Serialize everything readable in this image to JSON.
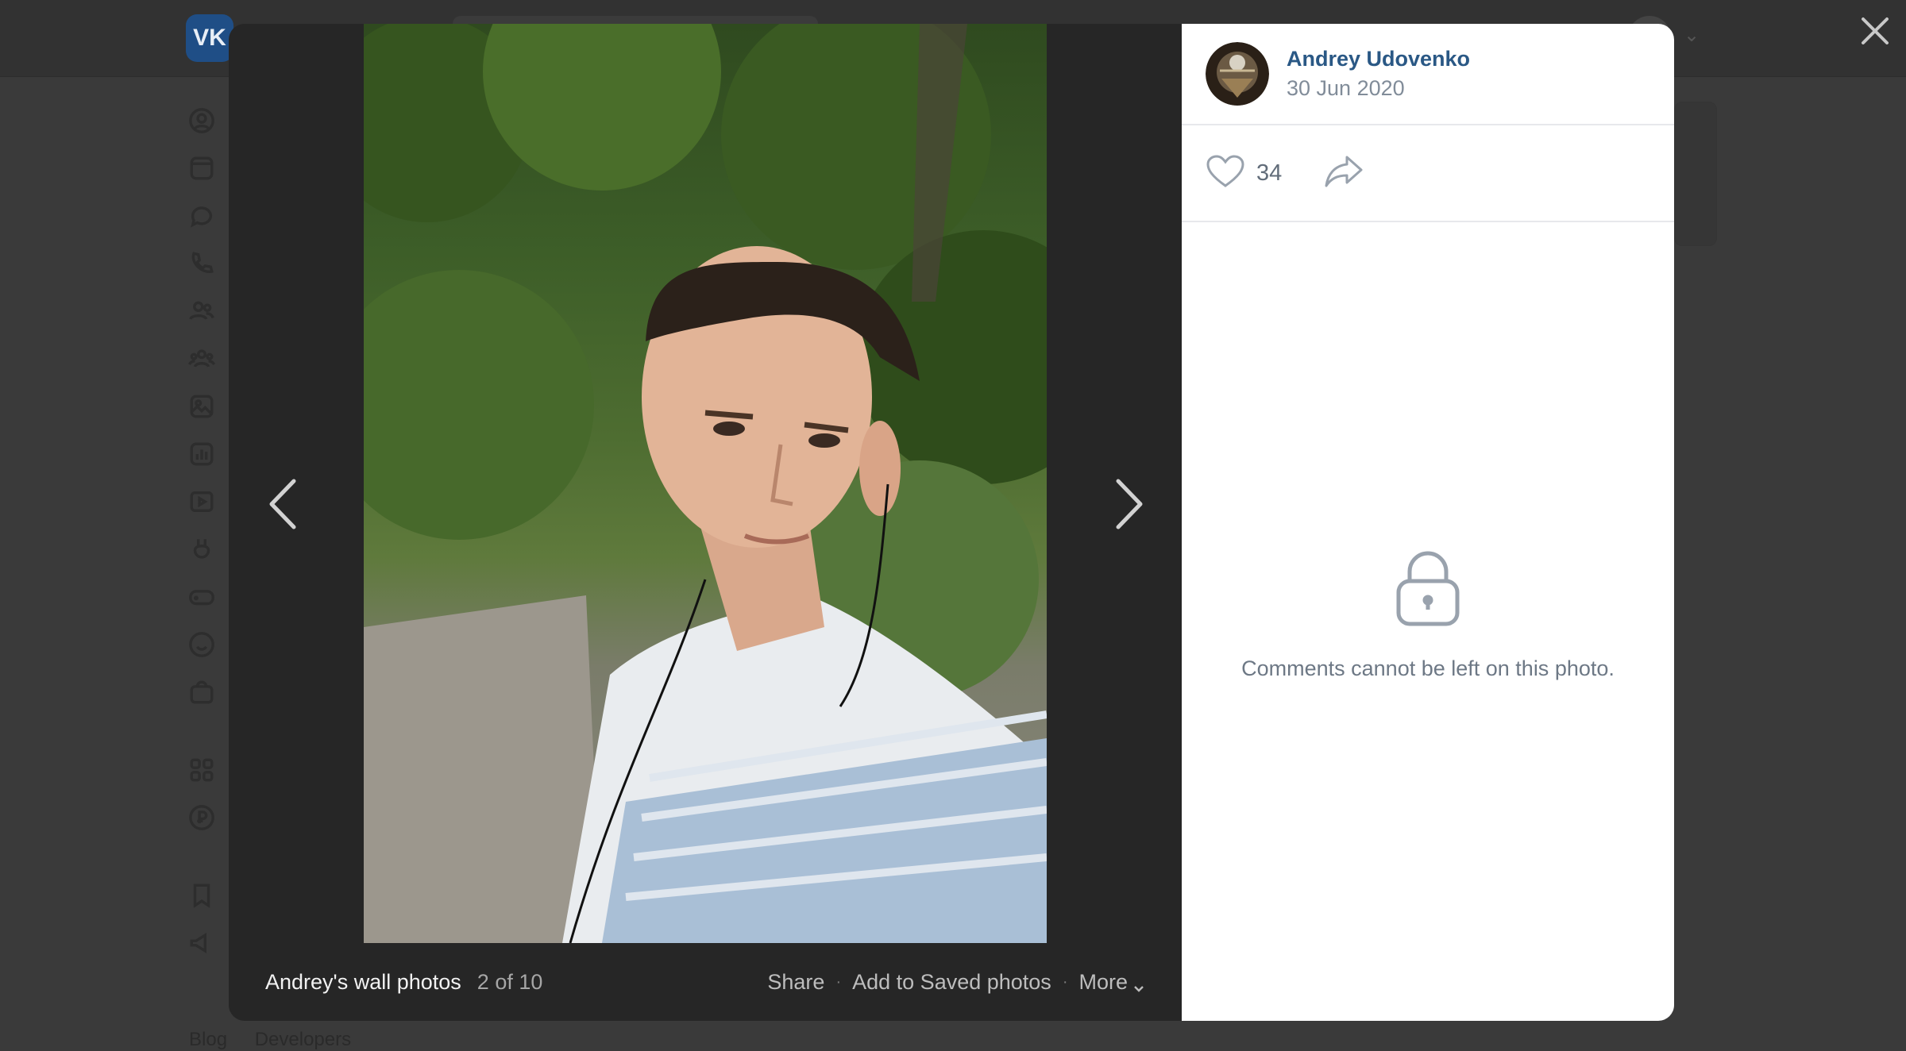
{
  "background": {
    "logo": "VK",
    "nav_icons": [
      "profile-icon",
      "news-icon",
      "messages-icon",
      "calls-icon",
      "friends-icon",
      "communities-icon",
      "photos-icon",
      "music-icon",
      "videos-icon",
      "clips-icon",
      "games-icon",
      "stickers-icon",
      "market-icon",
      "apps-icon",
      "payments-icon",
      "bookmarks-icon",
      "ads-icon"
    ],
    "footer": {
      "blog": "Blog",
      "developers": "Developers"
    }
  },
  "viewer": {
    "close_icon": "close-icon",
    "prev_icon": "chevron-left-icon",
    "next_icon": "chevron-right-icon",
    "album_name": "Andrey's wall photos",
    "counter": "2 of 10",
    "actions": {
      "share": "Share",
      "save": "Add to Saved photos",
      "more": "More"
    }
  },
  "sidebar": {
    "author": {
      "name": "Andrey Udovenko",
      "date": "30 Jun 2020"
    },
    "likes": "34",
    "like_icon": "heart-icon",
    "share_icon": "share-arrow-icon",
    "comments_locked_text": "Comments cannot be left on this photo.",
    "lock_icon": "lock-icon"
  },
  "colors": {
    "overlay": "#3a3a3a",
    "photo_pane": "#262626",
    "author_link": "#2a5885",
    "muted": "#818c99",
    "divider": "#e7e8ec"
  }
}
